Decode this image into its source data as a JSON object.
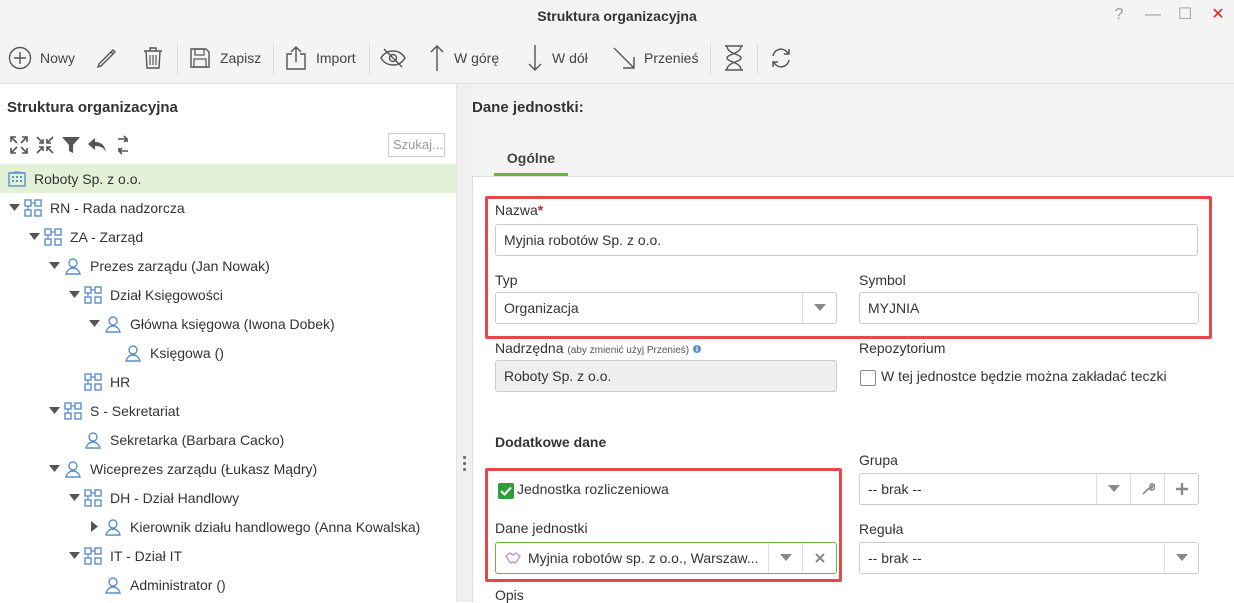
{
  "window": {
    "title": "Struktura organizacyjna",
    "help": "?",
    "minimize": "—",
    "maximize": "☐",
    "close": "✕"
  },
  "toolbar": {
    "new_label": "Nowy",
    "save_label": "Zapisz",
    "import_label": "Import",
    "up_label": "W górę",
    "down_label": "W dół",
    "move_label": "Przenieś"
  },
  "tree_panel": {
    "title": "Struktura organizacyjna",
    "search_placeholder": "Szukaj..."
  },
  "tree": [
    {
      "label": "Roboty Sp. z o.o.",
      "level": 0,
      "icon": "building-icon",
      "toggle": "none",
      "selected": true
    },
    {
      "label": "RN - Rada nadzorcza",
      "level": 0,
      "icon": "org-unit-icon",
      "toggle": "open"
    },
    {
      "label": "ZA - Zarząd",
      "level": 1,
      "icon": "org-unit-icon",
      "toggle": "open"
    },
    {
      "label": "Prezes zarządu (Jan Nowak)",
      "level": 2,
      "icon": "person-icon",
      "toggle": "open"
    },
    {
      "label": "Dział Księgowości",
      "level": 3,
      "icon": "org-unit-icon",
      "toggle": "open"
    },
    {
      "label": "Główna księgowa (Iwona Dobek)",
      "level": 4,
      "icon": "person-icon",
      "toggle": "open"
    },
    {
      "label": "Księgowa ()",
      "level": 5,
      "icon": "person-icon",
      "toggle": "none"
    },
    {
      "label": "HR",
      "level": 3,
      "icon": "org-unit-icon",
      "toggle": "none"
    },
    {
      "label": "S - Sekretariat",
      "level": 2,
      "icon": "org-unit-icon",
      "toggle": "open"
    },
    {
      "label": "Sekretarka (Barbara Cacko)",
      "level": 3,
      "icon": "person-icon",
      "toggle": "none"
    },
    {
      "label": "Wiceprezes zarządu (Łukasz Mądry)",
      "level": 2,
      "icon": "person-icon",
      "toggle": "open"
    },
    {
      "label": "DH - Dział Handlowy",
      "level": 3,
      "icon": "org-unit-icon",
      "toggle": "open"
    },
    {
      "label": "Kierownik działu handlowego (Anna Kowalska)",
      "level": 4,
      "icon": "person-icon",
      "toggle": "closed"
    },
    {
      "label": "IT - Dział IT",
      "level": 3,
      "icon": "org-unit-icon",
      "toggle": "open"
    },
    {
      "label": "Administrator ()",
      "level": 4,
      "icon": "person-icon",
      "toggle": "none"
    }
  ],
  "details": {
    "title": "Dane jednostki:",
    "tab_general": "Ogólne",
    "name_label": "Nazwa",
    "required_mark": "*",
    "name_value": "Myjnia robotów Sp. z o.o.",
    "type_label": "Typ",
    "type_value": "Organizacja",
    "symbol_label": "Symbol",
    "symbol_value": "MYJNIA",
    "parent_label": "Nadrzędna",
    "parent_hint": "(aby zmienić użyj Przenieś)",
    "parent_value": "Roboty Sp. z o.o.",
    "repo_label": "Repozytorium",
    "repo_checkbox_label": "W tej jednostce będzie można zakładać teczki",
    "extra_section": "Dodatkowe dane",
    "billing_unit_label": "Jednostka rozliczeniowa",
    "unit_data_label": "Dane jednostki",
    "unit_data_value": "Myjnia robotów sp. z o.o., Warszaw...",
    "group_label": "Grupa",
    "group_value": "-- brak --",
    "rule_label": "Reguła",
    "rule_value": "-- brak --",
    "description_label": "Opis"
  },
  "colors": {
    "accent_green": "#6db33f",
    "highlight_red": "#e8474a",
    "checkbox_green": "#2e9e3a",
    "selected_row": "#e4f1d9",
    "icon_blue": "#5b8fc9"
  }
}
